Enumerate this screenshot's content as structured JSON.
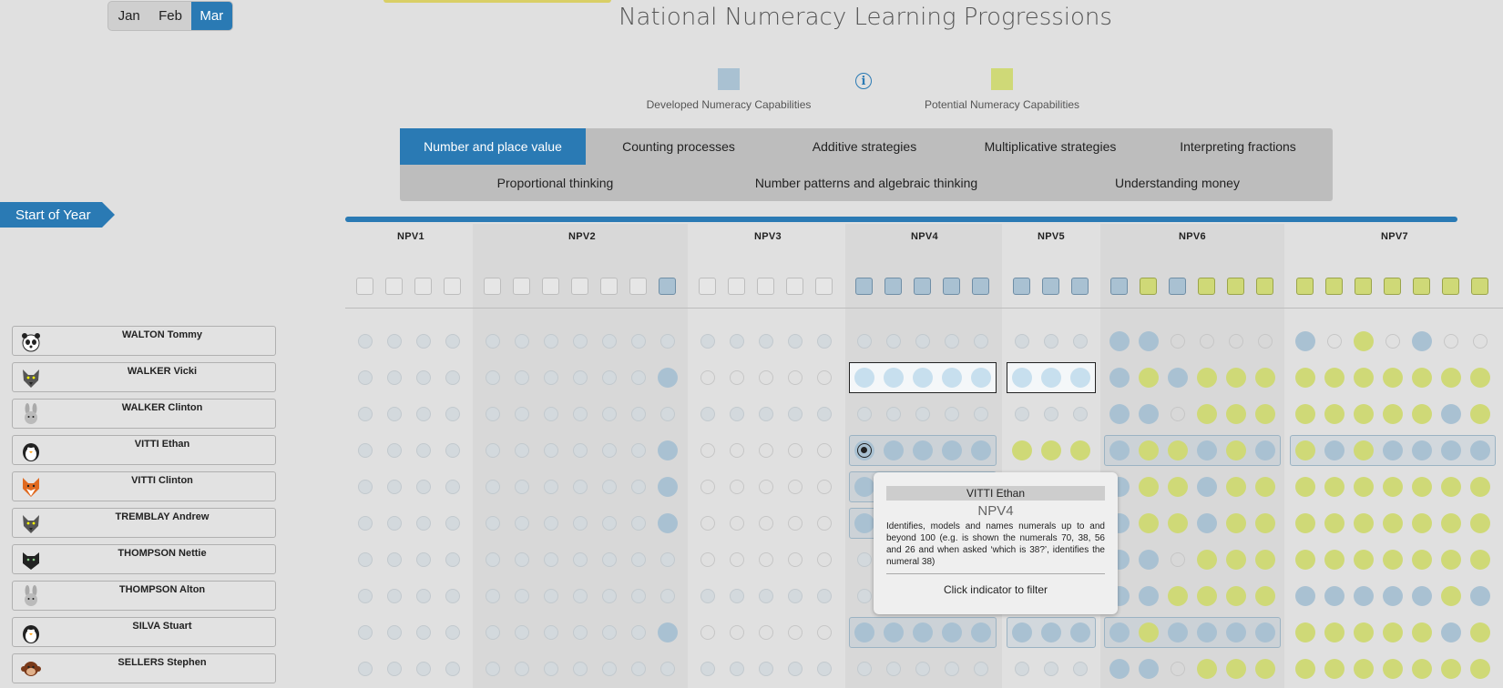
{
  "months": [
    {
      "label": "Jan",
      "active": false
    },
    {
      "label": "Feb",
      "active": false
    },
    {
      "label": "Mar",
      "active": true
    }
  ],
  "title": "National Numeracy Learning Progressions",
  "legend": {
    "developed_label": "Developed Numeracy Capabilities",
    "potential_label": "Potential Numeracy Capabilities",
    "info_glyph": "i",
    "developed_color": "#a9c1d2",
    "potential_color": "#cfd977"
  },
  "strands": {
    "row1": [
      "Number and place value",
      "Counting processes",
      "Additive strategies",
      "Multiplicative strategies",
      "Interpreting fractions"
    ],
    "row2": [
      "Proportional thinking",
      "Number patterns and algebraic thinking",
      "Understanding money"
    ],
    "active": "Number and place value"
  },
  "period_tag": "Start of Year",
  "levels": [
    "NPV1",
    "NPV2",
    "NPV3",
    "NPV4",
    "NPV5",
    "NPV6",
    "NPV7"
  ],
  "level_counts": [
    4,
    7,
    5,
    5,
    3,
    6,
    7
  ],
  "header_status": [
    "eeee",
    "eeeeeeb",
    "eeeee",
    "bbbbb",
    "bbb",
    "bybyyy",
    "yyyyyyy"
  ],
  "students": [
    {
      "name": "WALTON Tommy",
      "avatar": "panda",
      "dots": [
        "ssss",
        "sssssss",
        "sssss",
        "sssss",
        "sss",
        "bbeeee",
        "beyebee"
      ]
    },
    {
      "name": "WALKER Vicki",
      "avatar": "wolf",
      "dots": [
        "ssss",
        "ssssssb",
        "eeeee",
        "lllll",
        "lll",
        "bybyyy",
        "yyyyyyy"
      ]
    },
    {
      "name": "WALKER Clinton",
      "avatar": "rabbit",
      "dots": [
        "ssss",
        "sssssss",
        "sssss",
        "sssss",
        "sss",
        "bbeyyy",
        "yyyyyby"
      ]
    },
    {
      "name": "VITTI Ethan",
      "avatar": "penguin",
      "dots": [
        "ssss",
        "ssssssb",
        "eeeee",
        "xbbbb",
        "yyy",
        "byybyb",
        "ybybbbb"
      ]
    },
    {
      "name": "VITTI Clinton",
      "avatar": "fox",
      "dots": [
        "ssss",
        "ssssssb",
        "eeeee",
        "bbbbb",
        "bbb",
        "byybyy",
        "yyyyyyy"
      ]
    },
    {
      "name": "TREMBLAY Andrew",
      "avatar": "wolf",
      "dots": [
        "ssss",
        "ssssssb",
        "eeeee",
        "bbbbb",
        "bbb",
        "byybyy",
        "yyyyyyy"
      ]
    },
    {
      "name": "THOMPSON Nettie",
      "avatar": "panther",
      "dots": [
        "ssss",
        "sssssss",
        "eeeee",
        "sssss",
        "sss",
        "bbeyyy",
        "yyyyyyy"
      ]
    },
    {
      "name": "THOMPSON Alton",
      "avatar": "rabbit",
      "dots": [
        "ssss",
        "sssssss",
        "sssss",
        "sssss",
        "sss",
        "bbyyyy",
        "bbbbbyb"
      ]
    },
    {
      "name": "SILVA Stuart",
      "avatar": "penguin",
      "dots": [
        "ssss",
        "ssssssb",
        "eeeee",
        "bbbbb",
        "bbb",
        "bybbbb",
        "yyyyyby"
      ]
    },
    {
      "name": "SELLERS Stephen",
      "avatar": "monkey",
      "dots": [
        "ssss",
        "sssssss",
        "sssss",
        "sssss",
        "sss",
        "bbeyyy",
        "yyyyyyy"
      ]
    }
  ],
  "tooltip": {
    "student": "VITTI Ethan",
    "code": "NPV4",
    "description": "Identifies, models and names numerals up to and beyond 100 (e.g. is shown the numerals 70, 38, 56 and 26 and when asked ‘which is 38?’, identifies the numeral 38)",
    "action": "Click indicator to filter"
  }
}
